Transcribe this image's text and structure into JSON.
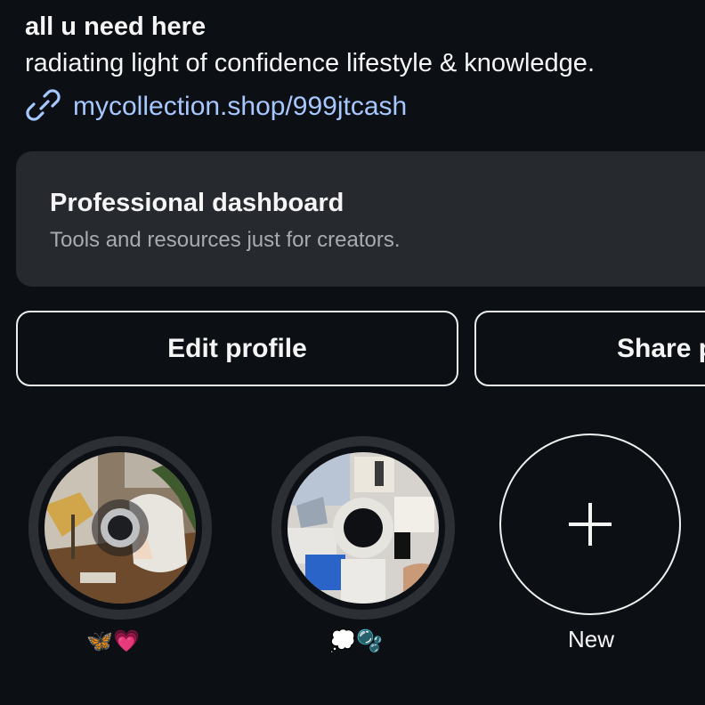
{
  "profile": {
    "name": "all u need here",
    "bio": "radiating light of confidence lifestyle & knowledge.",
    "link": "mycollection.shop/999jtcash",
    "link_icon": "link-icon"
  },
  "dashboard": {
    "title": "Professional dashboard",
    "subtitle": "Tools and resources just for creators."
  },
  "actions": {
    "edit_label": "Edit profile",
    "share_label": "Share p"
  },
  "highlights": [
    {
      "label": "🦋💗"
    },
    {
      "label": "💭🫧"
    }
  ],
  "new_highlight": {
    "label": "New",
    "icon": "plus-icon"
  },
  "colors": {
    "background": "#0c1014",
    "card": "#26292e",
    "link": "#a7c7ff",
    "subtitle": "#a8abb0"
  }
}
